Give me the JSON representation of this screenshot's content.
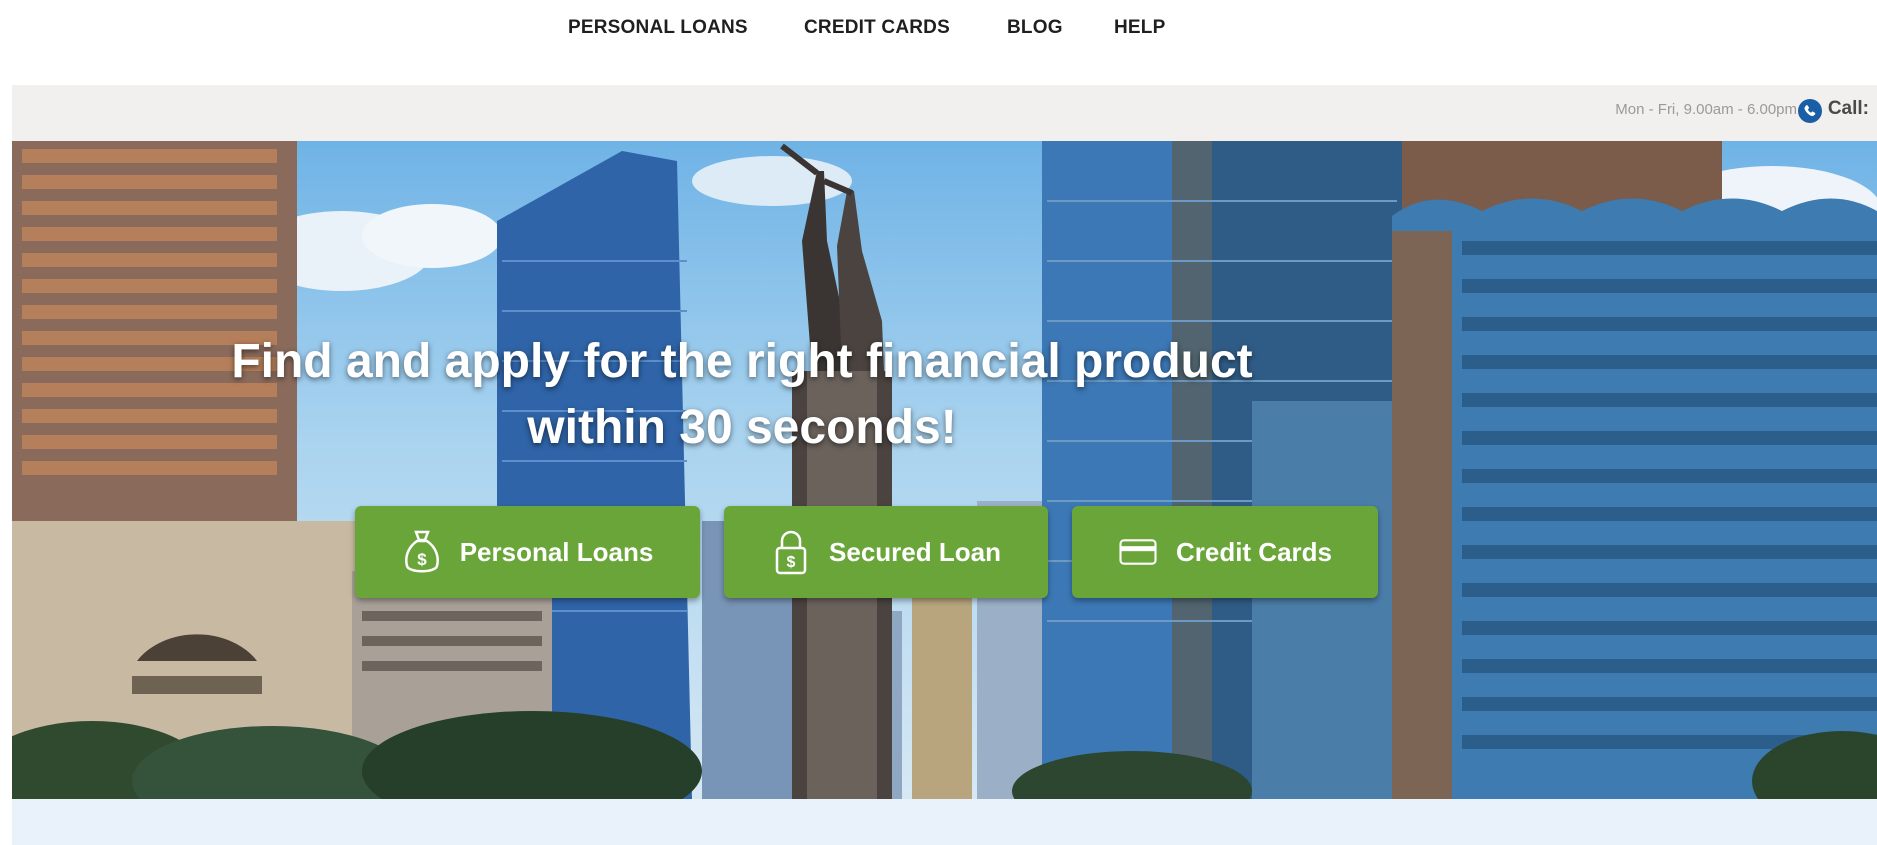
{
  "nav": {
    "items": [
      {
        "label": "PERSONAL LOANS"
      },
      {
        "label": "CREDIT CARDS"
      },
      {
        "label": "BLOG"
      },
      {
        "label": "HELP"
      }
    ]
  },
  "infobar": {
    "hours": "Mon - Fri, 9.00am - 6.00pm",
    "phone_icon": "phone-icon",
    "call_label": "Call:"
  },
  "hero": {
    "headline_line1": "Find and apply for the right financial product",
    "headline_line2": "within 30 seconds!",
    "buttons": [
      {
        "label": "Personal Loans",
        "icon": "money-bag-icon"
      },
      {
        "label": "Secured Loan",
        "icon": "padlock-dollar-icon"
      },
      {
        "label": "Credit Cards",
        "icon": "credit-card-icon"
      }
    ],
    "button_color": "#6aa53a"
  },
  "colors": {
    "accent_green": "#6aa53a",
    "phone_blue": "#1a5fa6",
    "infobar_bg": "#f2f0ee",
    "strip_bg": "#e9f2fb"
  }
}
